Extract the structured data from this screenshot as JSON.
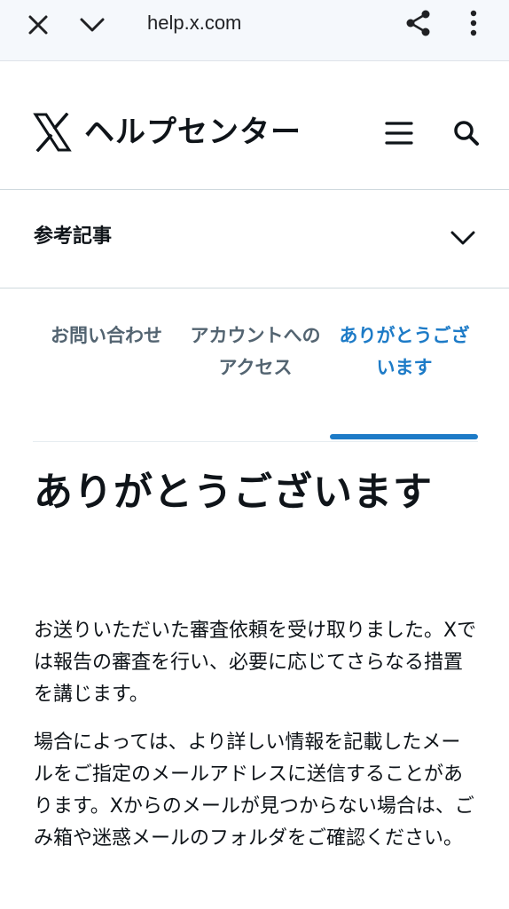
{
  "browser": {
    "url": "help.x.com"
  },
  "header": {
    "title": "ヘルプセンター"
  },
  "related": {
    "label": "参考記事"
  },
  "steps": [
    {
      "label": "お問い合わせ"
    },
    {
      "label": "アカウントへのアクセス"
    },
    {
      "label": "ありがとうございます"
    }
  ],
  "content": {
    "title": "ありがとうございます",
    "paragraph1": "お送りいただいた審査依頼を受け取りました。Xでは報告の審査を行い、必要に応じてさらなる措置を講じます。",
    "paragraph2": "場合によっては、より詳しい情報を記載したメールをご指定のメールアドレスに送信することがあります。Xからのメールが見つからない場合は、ごみ箱や迷惑メールのフォルダをご確認ください。"
  },
  "colors": {
    "accent": "#1d7bc7",
    "text": "#0f1419",
    "muted": "#536471",
    "browser_bar": "#f5f8fc"
  },
  "icons": {
    "close": "close-icon",
    "chevron": "chevron-down-icon",
    "share": "share-icon",
    "more": "more-vertical-icon",
    "logo": "x-logo-icon",
    "menu": "hamburger-menu-icon",
    "search": "search-icon"
  }
}
